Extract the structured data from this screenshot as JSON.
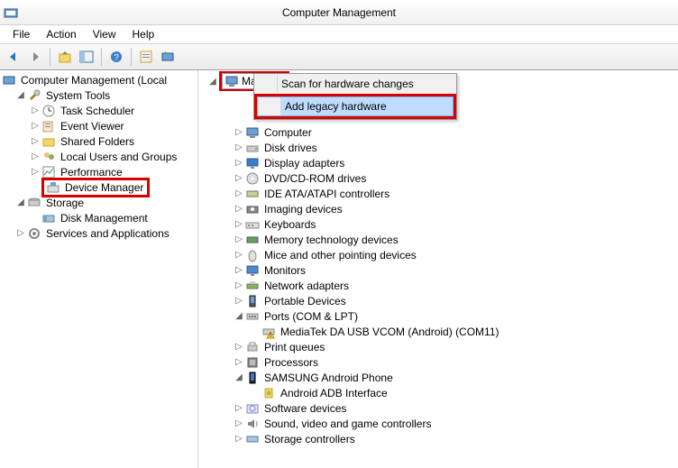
{
  "title": "Computer Management",
  "menubar": {
    "file": "File",
    "action": "Action",
    "view": "View",
    "help": "Help"
  },
  "left_tree": {
    "root": "Computer Management (Local",
    "system_tools": "System Tools",
    "task_scheduler": "Task Scheduler",
    "event_viewer": "Event Viewer",
    "shared_folders": "Shared Folders",
    "local_users": "Local Users and Groups",
    "performance": "Performance",
    "device_manager": "Device Manager",
    "storage": "Storage",
    "disk_management": "Disk Management",
    "services_apps": "Services and Applications"
  },
  "root_node": "Mai",
  "context_menu": {
    "scan": "Scan for hardware changes",
    "add_legacy": "Add legacy hardware"
  },
  "devices": [
    {
      "label": "Computer",
      "icon": "computer",
      "exp": "closed",
      "indent": 1
    },
    {
      "label": "Disk drives",
      "icon": "disk",
      "exp": "closed",
      "indent": 1
    },
    {
      "label": "Display adapters",
      "icon": "display",
      "exp": "closed",
      "indent": 1
    },
    {
      "label": "DVD/CD-ROM drives",
      "icon": "dvd",
      "exp": "closed",
      "indent": 1
    },
    {
      "label": "IDE ATA/ATAPI controllers",
      "icon": "ide",
      "exp": "closed",
      "indent": 1
    },
    {
      "label": "Imaging devices",
      "icon": "imaging",
      "exp": "closed",
      "indent": 1
    },
    {
      "label": "Keyboards",
      "icon": "keyboard",
      "exp": "closed",
      "indent": 1
    },
    {
      "label": "Memory technology devices",
      "icon": "memory",
      "exp": "closed",
      "indent": 1
    },
    {
      "label": "Mice and other pointing devices",
      "icon": "mouse",
      "exp": "closed",
      "indent": 1
    },
    {
      "label": "Monitors",
      "icon": "monitor",
      "exp": "closed",
      "indent": 1
    },
    {
      "label": "Network adapters",
      "icon": "network",
      "exp": "closed",
      "indent": 1
    },
    {
      "label": "Portable Devices",
      "icon": "portable",
      "exp": "closed",
      "indent": 1
    },
    {
      "label": "Ports (COM & LPT)",
      "icon": "ports",
      "exp": "open",
      "indent": 1
    },
    {
      "label": "MediaTek DA USB VCOM (Android) (COM11)",
      "icon": "port-warn",
      "exp": "none",
      "indent": 2
    },
    {
      "label": "Print queues",
      "icon": "printer",
      "exp": "closed",
      "indent": 1
    },
    {
      "label": "Processors",
      "icon": "cpu",
      "exp": "closed",
      "indent": 1
    },
    {
      "label": "SAMSUNG Android Phone",
      "icon": "phone",
      "exp": "open",
      "indent": 1
    },
    {
      "label": "Android ADB Interface",
      "icon": "adb",
      "exp": "none",
      "indent": 2
    },
    {
      "label": "Software devices",
      "icon": "software",
      "exp": "closed",
      "indent": 1
    },
    {
      "label": "Sound, video and game controllers",
      "icon": "sound",
      "exp": "closed",
      "indent": 1
    },
    {
      "label": "Storage controllers",
      "icon": "storage-ctrl",
      "exp": "closed",
      "indent": 1
    }
  ]
}
